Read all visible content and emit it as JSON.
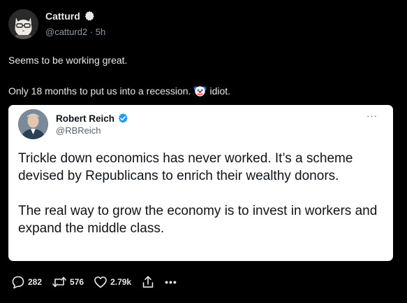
{
  "post": {
    "author_name": "Catturd",
    "handle": "@catturd2",
    "separator": "·",
    "time": "5h",
    "text_line1": "Seems to be working great.",
    "text_line2_before": "Only 18 months to put us into a recession.",
    "text_line2_emoji": "clown-face-icon",
    "text_line2_after": "idiot."
  },
  "quote": {
    "author_name": "Robert Reich",
    "handle": "@RBReich",
    "more": "···",
    "paragraph1": "Trickle down economics has never worked. It’s a scheme devised by Republicans to enrich their wealthy donors.",
    "paragraph2": "The real way to grow the economy is to invest in workers and expand the middle class."
  },
  "actions": {
    "replies": "282",
    "reposts": "576",
    "likes": "2.79k",
    "more": "•••"
  },
  "colors": {
    "background": "#000000",
    "text": "#e7e9ea",
    "muted": "#8b98a5",
    "verified_blue": "#1d9bf0",
    "card": "#ffffff"
  }
}
